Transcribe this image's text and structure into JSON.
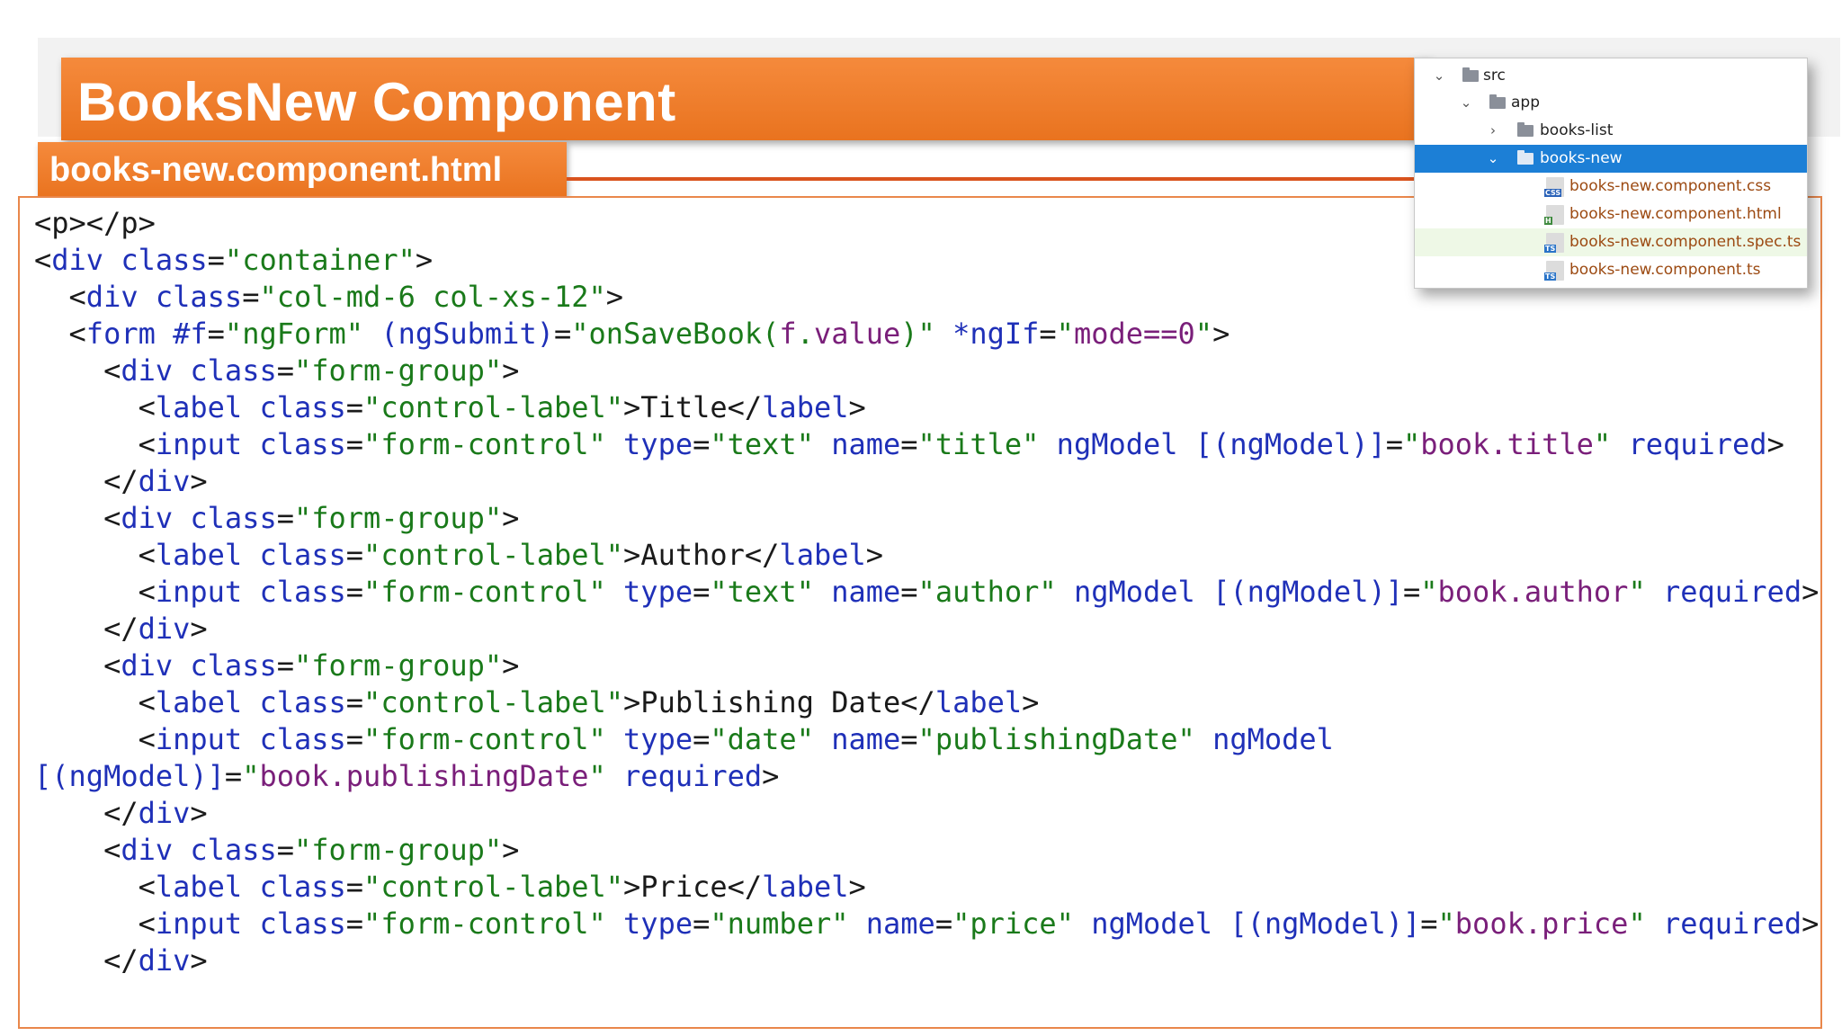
{
  "slide": {
    "title": "BooksNew Component",
    "file_tab": "books-new.component.html"
  },
  "code_lines": [
    [
      [
        "t-tag",
        "<p></p>"
      ]
    ],
    [
      [
        "t-tag",
        "<"
      ],
      [
        "t-name",
        "div"
      ],
      [
        "t-text",
        " "
      ],
      [
        "t-attr",
        "class"
      ],
      [
        "t-text",
        "="
      ],
      [
        "t-str",
        "\"container\""
      ],
      [
        "t-tag",
        ">"
      ]
    ],
    [
      [
        "t-text",
        "  "
      ],
      [
        "t-tag",
        "<"
      ],
      [
        "t-name",
        "div"
      ],
      [
        "t-text",
        " "
      ],
      [
        "t-attr",
        "class"
      ],
      [
        "t-text",
        "="
      ],
      [
        "t-str",
        "\"col-md-6 col-xs-12\""
      ],
      [
        "t-tag",
        ">"
      ]
    ],
    [
      [
        "t-text",
        "  "
      ],
      [
        "t-tag",
        "<"
      ],
      [
        "t-name",
        "form"
      ],
      [
        "t-text",
        " "
      ],
      [
        "t-attr",
        "#f"
      ],
      [
        "t-text",
        "="
      ],
      [
        "t-str",
        "\"ngForm\""
      ],
      [
        "t-text",
        " "
      ],
      [
        "t-attr",
        "(ngSubmit)"
      ],
      [
        "t-text",
        "="
      ],
      [
        "t-str",
        "\"onSaveBook("
      ],
      [
        "t-val",
        "f"
      ],
      [
        "t-str",
        "."
      ],
      [
        "t-val",
        "value"
      ],
      [
        "t-str",
        ")\""
      ],
      [
        "t-text",
        " "
      ],
      [
        "t-attr",
        "*ngIf"
      ],
      [
        "t-text",
        "="
      ],
      [
        "t-str",
        "\""
      ],
      [
        "t-val",
        "mode==0"
      ],
      [
        "t-str",
        "\""
      ],
      [
        "t-tag",
        ">"
      ]
    ],
    [
      [
        "t-text",
        "    "
      ],
      [
        "t-tag",
        "<"
      ],
      [
        "t-name",
        "div"
      ],
      [
        "t-text",
        " "
      ],
      [
        "t-attr",
        "class"
      ],
      [
        "t-text",
        "="
      ],
      [
        "t-str",
        "\"form-group\""
      ],
      [
        "t-tag",
        ">"
      ]
    ],
    [
      [
        "t-text",
        "      "
      ],
      [
        "t-tag",
        "<"
      ],
      [
        "t-name",
        "label"
      ],
      [
        "t-text",
        " "
      ],
      [
        "t-attr",
        "class"
      ],
      [
        "t-text",
        "="
      ],
      [
        "t-str",
        "\"control-label\""
      ],
      [
        "t-tag",
        ">"
      ],
      [
        "t-text",
        "Title"
      ],
      [
        "t-tag",
        "</"
      ],
      [
        "t-name",
        "label"
      ],
      [
        "t-tag",
        ">"
      ]
    ],
    [
      [
        "t-text",
        "      "
      ],
      [
        "t-tag",
        "<"
      ],
      [
        "t-name",
        "input"
      ],
      [
        "t-text",
        " "
      ],
      [
        "t-attr",
        "class"
      ],
      [
        "t-text",
        "="
      ],
      [
        "t-str",
        "\"form-control\""
      ],
      [
        "t-text",
        " "
      ],
      [
        "t-attr",
        "type"
      ],
      [
        "t-text",
        "="
      ],
      [
        "t-str",
        "\"text\""
      ],
      [
        "t-text",
        " "
      ],
      [
        "t-attr",
        "name"
      ],
      [
        "t-text",
        "="
      ],
      [
        "t-str",
        "\"title\""
      ],
      [
        "t-text",
        " "
      ],
      [
        "t-attr",
        "ngModel"
      ],
      [
        "t-text",
        " "
      ],
      [
        "t-attr",
        "[(ngModel)]"
      ],
      [
        "t-text",
        "="
      ],
      [
        "t-str",
        "\""
      ],
      [
        "t-val",
        "book.title"
      ],
      [
        "t-str",
        "\""
      ],
      [
        "t-text",
        " "
      ],
      [
        "t-attr",
        "required"
      ],
      [
        "t-tag",
        ">"
      ]
    ],
    [
      [
        "t-text",
        "    "
      ],
      [
        "t-tag",
        "</"
      ],
      [
        "t-name",
        "div"
      ],
      [
        "t-tag",
        ">"
      ]
    ],
    [
      [
        "t-text",
        "    "
      ],
      [
        "t-tag",
        "<"
      ],
      [
        "t-name",
        "div"
      ],
      [
        "t-text",
        " "
      ],
      [
        "t-attr",
        "class"
      ],
      [
        "t-text",
        "="
      ],
      [
        "t-str",
        "\"form-group\""
      ],
      [
        "t-tag",
        ">"
      ]
    ],
    [
      [
        "t-text",
        "      "
      ],
      [
        "t-tag",
        "<"
      ],
      [
        "t-name",
        "label"
      ],
      [
        "t-text",
        " "
      ],
      [
        "t-attr",
        "class"
      ],
      [
        "t-text",
        "="
      ],
      [
        "t-str",
        "\"control-label\""
      ],
      [
        "t-tag",
        ">"
      ],
      [
        "t-text",
        "Author"
      ],
      [
        "t-tag",
        "</"
      ],
      [
        "t-name",
        "label"
      ],
      [
        "t-tag",
        ">"
      ]
    ],
    [
      [
        "t-text",
        "      "
      ],
      [
        "t-tag",
        "<"
      ],
      [
        "t-name",
        "input"
      ],
      [
        "t-text",
        " "
      ],
      [
        "t-attr",
        "class"
      ],
      [
        "t-text",
        "="
      ],
      [
        "t-str",
        "\"form-control\""
      ],
      [
        "t-text",
        " "
      ],
      [
        "t-attr",
        "type"
      ],
      [
        "t-text",
        "="
      ],
      [
        "t-str",
        "\"text\""
      ],
      [
        "t-text",
        " "
      ],
      [
        "t-attr",
        "name"
      ],
      [
        "t-text",
        "="
      ],
      [
        "t-str",
        "\"author\""
      ],
      [
        "t-text",
        " "
      ],
      [
        "t-attr",
        "ngModel"
      ],
      [
        "t-text",
        " "
      ],
      [
        "t-attr",
        "[(ngModel)]"
      ],
      [
        "t-text",
        "="
      ],
      [
        "t-str",
        "\""
      ],
      [
        "t-val",
        "book.author"
      ],
      [
        "t-str",
        "\""
      ],
      [
        "t-text",
        " "
      ],
      [
        "t-attr",
        "required"
      ],
      [
        "t-tag",
        ">"
      ]
    ],
    [
      [
        "t-text",
        "    "
      ],
      [
        "t-tag",
        "</"
      ],
      [
        "t-name",
        "div"
      ],
      [
        "t-tag",
        ">"
      ]
    ],
    [
      [
        "t-text",
        "    "
      ],
      [
        "t-tag",
        "<"
      ],
      [
        "t-name",
        "div"
      ],
      [
        "t-text",
        " "
      ],
      [
        "t-attr",
        "class"
      ],
      [
        "t-text",
        "="
      ],
      [
        "t-str",
        "\"form-group\""
      ],
      [
        "t-tag",
        ">"
      ]
    ],
    [
      [
        "t-text",
        "      "
      ],
      [
        "t-tag",
        "<"
      ],
      [
        "t-name",
        "label"
      ],
      [
        "t-text",
        " "
      ],
      [
        "t-attr",
        "class"
      ],
      [
        "t-text",
        "="
      ],
      [
        "t-str",
        "\"control-label\""
      ],
      [
        "t-tag",
        ">"
      ],
      [
        "t-text",
        "Publishing Date"
      ],
      [
        "t-tag",
        "</"
      ],
      [
        "t-name",
        "label"
      ],
      [
        "t-tag",
        ">"
      ]
    ],
    [
      [
        "t-text",
        "      "
      ],
      [
        "t-tag",
        "<"
      ],
      [
        "t-name",
        "input"
      ],
      [
        "t-text",
        " "
      ],
      [
        "t-attr",
        "class"
      ],
      [
        "t-text",
        "="
      ],
      [
        "t-str",
        "\"form-control\""
      ],
      [
        "t-text",
        " "
      ],
      [
        "t-attr",
        "type"
      ],
      [
        "t-text",
        "="
      ],
      [
        "t-str",
        "\"date\""
      ],
      [
        "t-text",
        " "
      ],
      [
        "t-attr",
        "name"
      ],
      [
        "t-text",
        "="
      ],
      [
        "t-str",
        "\"publishingDate\""
      ],
      [
        "t-text",
        " "
      ],
      [
        "t-attr",
        "ngModel"
      ]
    ],
    [
      [
        "t-attr",
        "[(ngModel)]"
      ],
      [
        "t-text",
        "="
      ],
      [
        "t-str",
        "\""
      ],
      [
        "t-val",
        "book.publishingDate"
      ],
      [
        "t-str",
        "\""
      ],
      [
        "t-text",
        " "
      ],
      [
        "t-attr",
        "required"
      ],
      [
        "t-tag",
        ">"
      ]
    ],
    [
      [
        "t-text",
        "    "
      ],
      [
        "t-tag",
        "</"
      ],
      [
        "t-name",
        "div"
      ],
      [
        "t-tag",
        ">"
      ]
    ],
    [
      [
        "t-text",
        "    "
      ],
      [
        "t-tag",
        "<"
      ],
      [
        "t-name",
        "div"
      ],
      [
        "t-text",
        " "
      ],
      [
        "t-attr",
        "class"
      ],
      [
        "t-text",
        "="
      ],
      [
        "t-str",
        "\"form-group\""
      ],
      [
        "t-tag",
        ">"
      ]
    ],
    [
      [
        "t-text",
        "      "
      ],
      [
        "t-tag",
        "<"
      ],
      [
        "t-name",
        "label"
      ],
      [
        "t-text",
        " "
      ],
      [
        "t-attr",
        "class"
      ],
      [
        "t-text",
        "="
      ],
      [
        "t-str",
        "\"control-label\""
      ],
      [
        "t-tag",
        ">"
      ],
      [
        "t-text",
        "Price"
      ],
      [
        "t-tag",
        "</"
      ],
      [
        "t-name",
        "label"
      ],
      [
        "t-tag",
        ">"
      ]
    ],
    [
      [
        "t-text",
        "      "
      ],
      [
        "t-tag",
        "<"
      ],
      [
        "t-name",
        "input"
      ],
      [
        "t-text",
        " "
      ],
      [
        "t-attr",
        "class"
      ],
      [
        "t-text",
        "="
      ],
      [
        "t-str",
        "\"form-control\""
      ],
      [
        "t-text",
        " "
      ],
      [
        "t-attr",
        "type"
      ],
      [
        "t-text",
        "="
      ],
      [
        "t-str",
        "\"number\""
      ],
      [
        "t-text",
        " "
      ],
      [
        "t-attr",
        "name"
      ],
      [
        "t-text",
        "="
      ],
      [
        "t-str",
        "\"price\""
      ],
      [
        "t-text",
        " "
      ],
      [
        "t-attr",
        "ngModel"
      ],
      [
        "t-text",
        " "
      ],
      [
        "t-attr",
        "[(ngModel)]"
      ],
      [
        "t-text",
        "="
      ],
      [
        "t-str",
        "\""
      ],
      [
        "t-val",
        "book.price"
      ],
      [
        "t-str",
        "\""
      ],
      [
        "t-text",
        " "
      ],
      [
        "t-attr",
        "required"
      ],
      [
        "t-tag",
        ">"
      ]
    ],
    [
      [
        "t-text",
        "    "
      ],
      [
        "t-tag",
        "</"
      ],
      [
        "t-name",
        "div"
      ],
      [
        "t-tag",
        ">"
      ]
    ]
  ],
  "project_tree": {
    "folders": [
      {
        "label": "src",
        "expanded": true
      },
      {
        "label": "app",
        "expanded": true
      },
      {
        "label": "books-list",
        "expanded": false
      },
      {
        "label": "books-new",
        "expanded": true,
        "selected": true
      }
    ],
    "files": [
      {
        "label": "books-new.component.css",
        "icon": "css-file-icon",
        "badge": "CSS"
      },
      {
        "label": "books-new.component.html",
        "icon": "html-file-icon",
        "badge": "H"
      },
      {
        "label": "books-new.component.spec.ts",
        "icon": "spec-ts-file-icon",
        "badge": "TS"
      },
      {
        "label": "books-new.component.ts",
        "icon": "ts-file-icon",
        "badge": "TS"
      }
    ],
    "colors": {
      "selected_bg": "#1c7fd6",
      "file_label": "#9c4a12"
    }
  }
}
